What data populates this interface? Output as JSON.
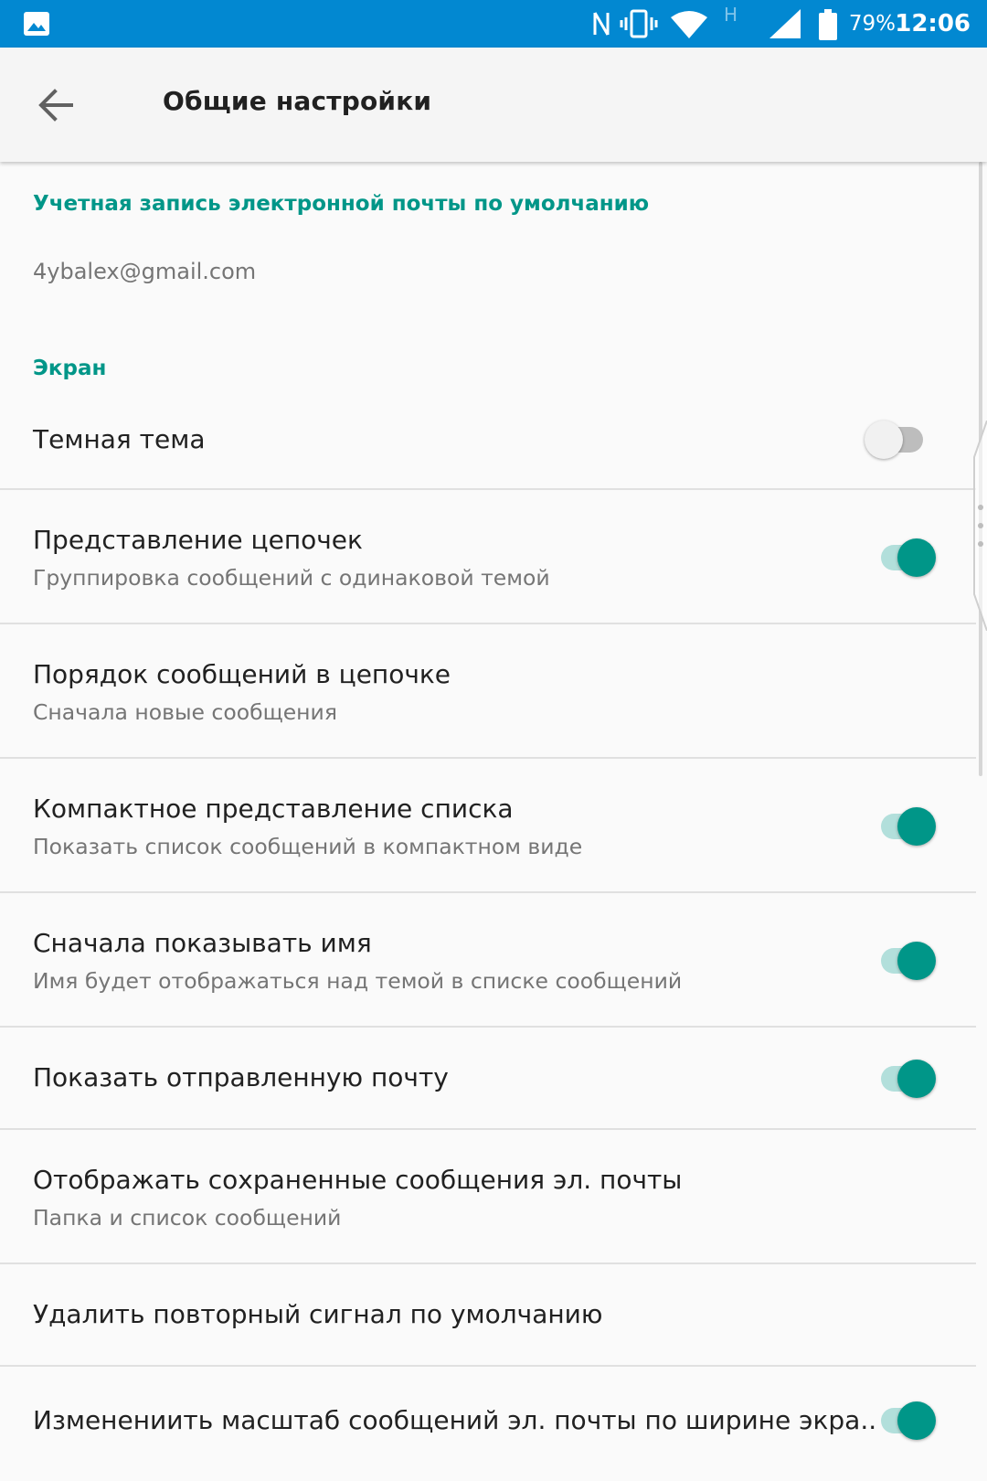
{
  "status_bar": {
    "battery_percent": "79%",
    "time": "12:06",
    "network_type": "H",
    "icons": [
      "image-icon",
      "nfc-icon",
      "vibrate-icon",
      "wifi-icon",
      "signal-icon",
      "battery-icon"
    ],
    "background_color": "#0288d1"
  },
  "app_bar": {
    "title": "Общие настройки",
    "back_icon": "arrow-back-icon"
  },
  "sections": {
    "default_account": {
      "header": "Учетная запись электронной почты по умолчанию",
      "value": "4ybalex@gmail.com"
    },
    "screen": {
      "header": "Экран"
    }
  },
  "preferences": [
    {
      "title": "Темная тема",
      "summary": "",
      "switch": "off"
    },
    {
      "title": "Представление цепочек",
      "summary": "Группировка сообщений с одинаковой темой",
      "switch": "on"
    },
    {
      "title": "Порядок сообщений в цепочке",
      "summary": "Сначала новые сообщения",
      "switch": "none"
    },
    {
      "title": "Компактное представление списка",
      "summary": "Показать список сообщений в компактном виде",
      "switch": "on"
    },
    {
      "title": "Сначала показывать имя",
      "summary": "Имя будет отображаться над темой в списке сообщений",
      "switch": "on"
    },
    {
      "title": "Показать отправленную почту",
      "summary": "",
      "switch": "on"
    },
    {
      "title": "Отображать сохраненные сообщения эл. почты",
      "summary": "Папка и список сообщений",
      "switch": "none"
    },
    {
      "title": "Удалить повторный сигнал по умолчанию",
      "summary": "",
      "switch": "none"
    },
    {
      "title": "Изменениить масштаб сообщений эл. почты по ширине экра..",
      "summary": "",
      "switch": "on"
    }
  ],
  "colors": {
    "accent": "#009688",
    "accent_track": "#b2dfdb",
    "primary_text": "#212121",
    "secondary_text": "#757575"
  }
}
